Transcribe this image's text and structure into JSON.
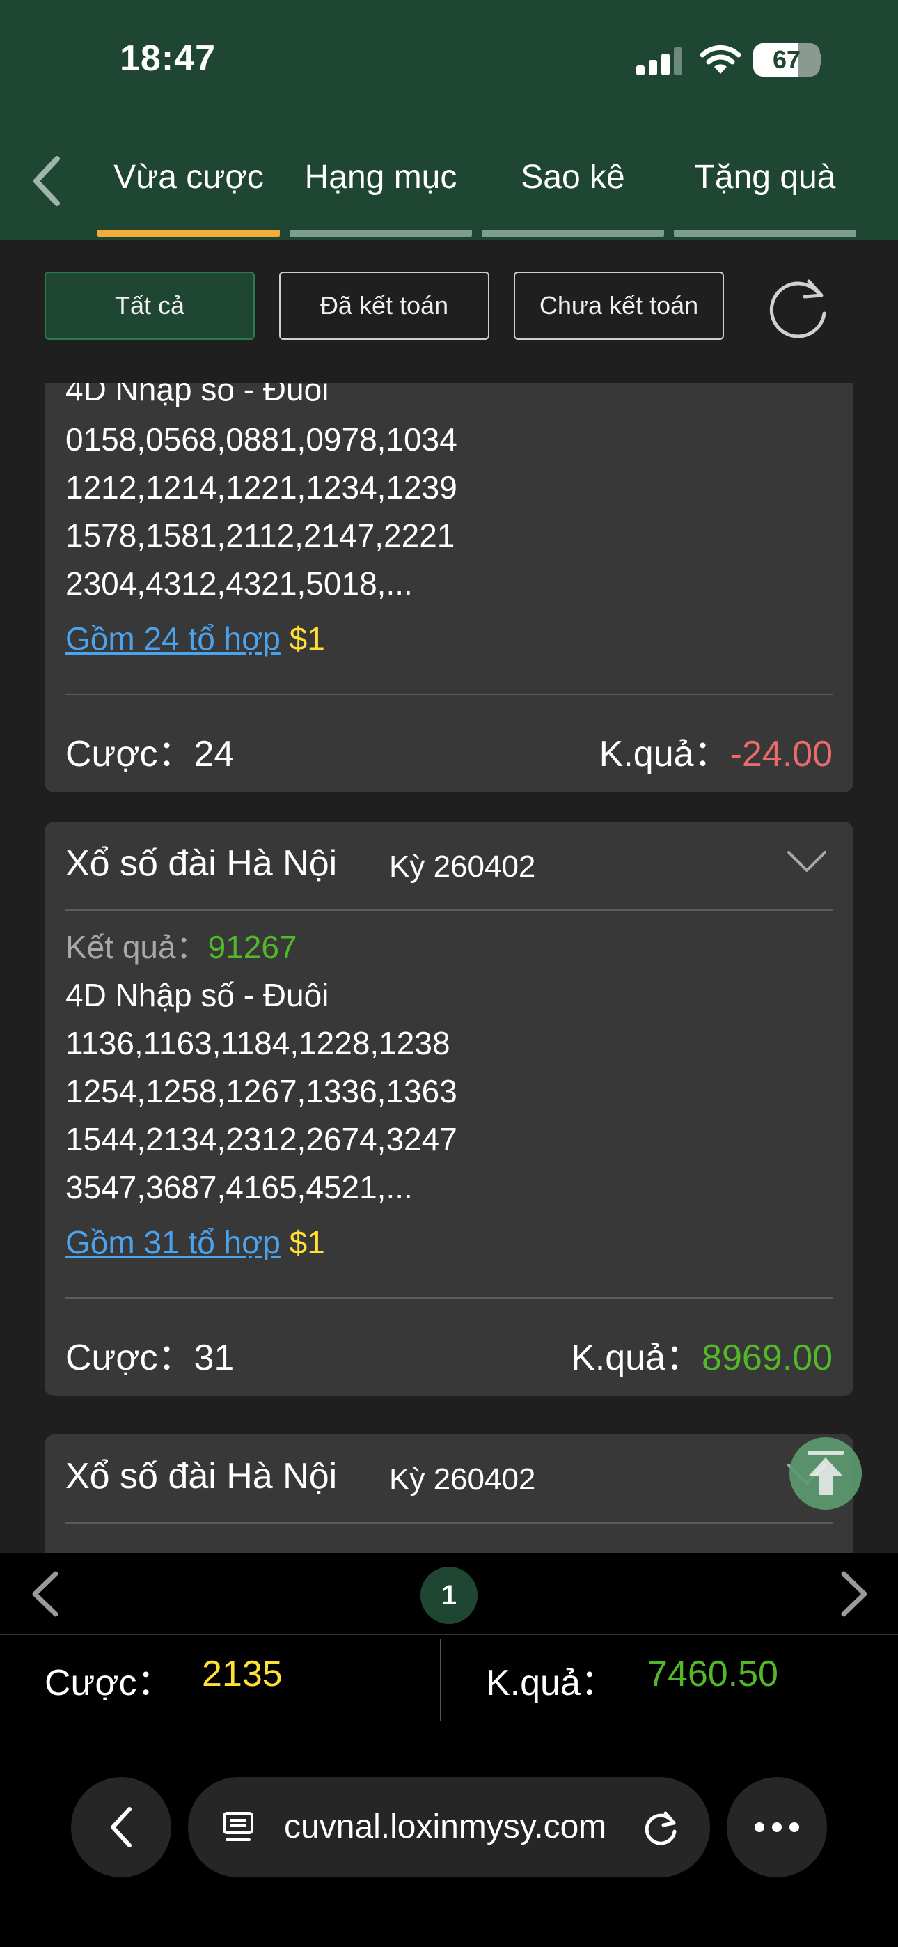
{
  "status_bar": {
    "time": "18:47",
    "battery": "67",
    "battery_level": 0.67
  },
  "tabs": [
    {
      "label": "Vừa cược",
      "active": true
    },
    {
      "label": "Hạng mục",
      "active": false
    },
    {
      "label": "Sao kê",
      "active": false
    },
    {
      "label": "Tặng quà",
      "active": false
    }
  ],
  "filters": {
    "all": "Tất cả",
    "settled": "Đã kết toán",
    "unsettled": "Chưa kết toán"
  },
  "cards": [
    {
      "lines": [
        "4D Nhập số - Đuôi",
        "0158,0568,0881,0978,1034",
        "1212,1214,1221,1234,1239",
        "1578,1581,2112,2147,2221",
        "2304,4312,4321,5018,..."
      ],
      "combo_link": "Gồm 24 tổ hợp",
      "combo_amount": "$1",
      "bet_label": "Cược：24",
      "result_label": "K.quả：",
      "result_value": "-24.00"
    },
    {
      "title": "Xổ số đài Hà Nội",
      "period": "Kỳ 260402",
      "draw_label": "Kết quả：",
      "draw_value": "91267",
      "lines": [
        "4D Nhập số - Đuôi",
        "1136,1163,1184,1228,1238",
        "1254,1258,1267,1336,1363",
        "1544,2134,2312,2674,3247",
        "3547,3687,4165,4521,..."
      ],
      "combo_link": "Gồm 31 tổ hợp",
      "combo_amount": "$1",
      "bet_label": "Cược：31",
      "result_label": "K.quả：",
      "result_value": "8969.00"
    },
    {
      "title": "Xổ số đài Hà Nội",
      "period": "Kỳ 260402"
    }
  ],
  "pager": {
    "page": "1"
  },
  "totals": {
    "bet_label": "Cược：",
    "bet_value": "2135",
    "result_label": "K.quả：",
    "result_value": "7460.50"
  },
  "browser": {
    "url": "cuvnal.loxinmysy.com"
  },
  "colors": {
    "header_green": "#1e4633",
    "active_tab": "#f2ad38",
    "negative": "#ea6b6b",
    "positive": "#52b82a",
    "link": "#4ba3ee",
    "amount": "#ffe033"
  }
}
